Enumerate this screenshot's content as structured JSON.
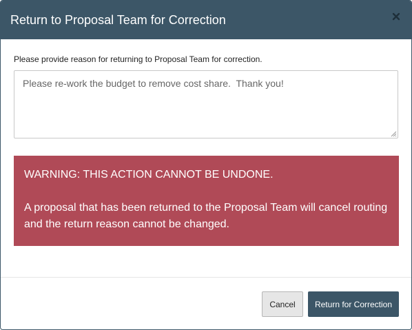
{
  "dialog": {
    "title": "Return to Proposal Team for Correction",
    "close_icon": "close-icon"
  },
  "form": {
    "prompt": "Please provide reason for returning to Proposal Team for correction.",
    "reason_value": "Please re-work the budget to remove cost share.  Thank you!"
  },
  "warning": {
    "title": "WARNING: THIS ACTION CANNOT BE UNDONE.",
    "message": "A proposal that has been returned to the Proposal Team will cancel routing and the return reason cannot be changed."
  },
  "footer": {
    "cancel_label": "Cancel",
    "submit_label": "Return for Correction"
  },
  "colors": {
    "header_bg": "#3c5667",
    "warning_bg": "#b04a57",
    "primary_button": "#3c5667"
  }
}
